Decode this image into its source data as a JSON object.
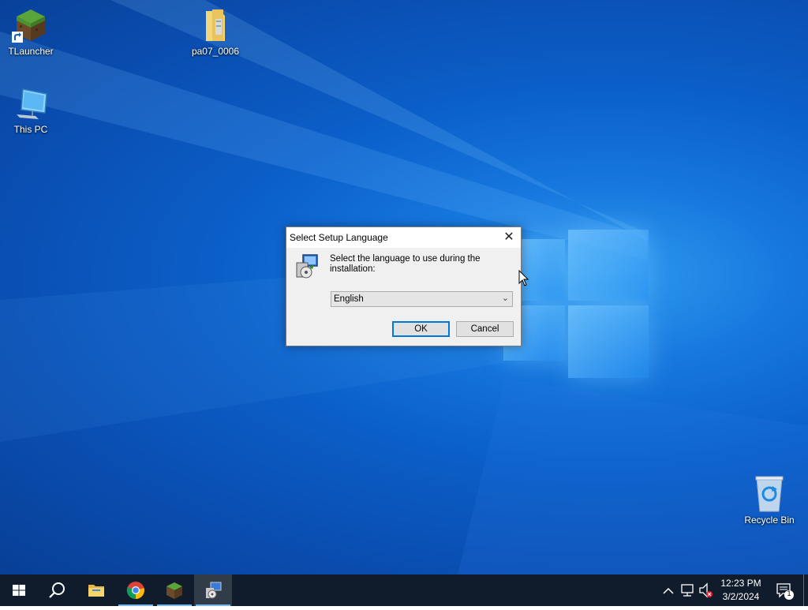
{
  "desktop": {
    "icons": [
      {
        "label": "TLauncher",
        "icon": "minecraft-grass-block-icon"
      },
      {
        "label": "pa07_0006",
        "icon": "folder-icon"
      },
      {
        "label": "This PC",
        "icon": "computer-icon"
      },
      {
        "label": "Recycle Bin",
        "icon": "recycle-bin-icon"
      }
    ]
  },
  "dialog": {
    "title": "Select Setup Language",
    "prompt": "Select the language to use during the installation:",
    "language_selected": "English",
    "ok_label": "OK",
    "cancel_label": "Cancel",
    "close_glyph": "✕"
  },
  "taskbar": {
    "apps": [
      {
        "name": "start",
        "icon": "windows-start-icon"
      },
      {
        "name": "search",
        "icon": "search-icon"
      },
      {
        "name": "file-explorer",
        "icon": "folder-icon"
      },
      {
        "name": "chrome",
        "icon": "chrome-icon"
      },
      {
        "name": "tlauncher",
        "icon": "minecraft-grass-block-icon"
      },
      {
        "name": "setup",
        "icon": "setup-installer-icon"
      }
    ],
    "time": "12:23 PM",
    "date": "3/2/2024",
    "notification_count": "1"
  },
  "colors": {
    "accent": "#0078d7",
    "taskbar": "#101c2b",
    "desktop": "#0b5fc9"
  }
}
